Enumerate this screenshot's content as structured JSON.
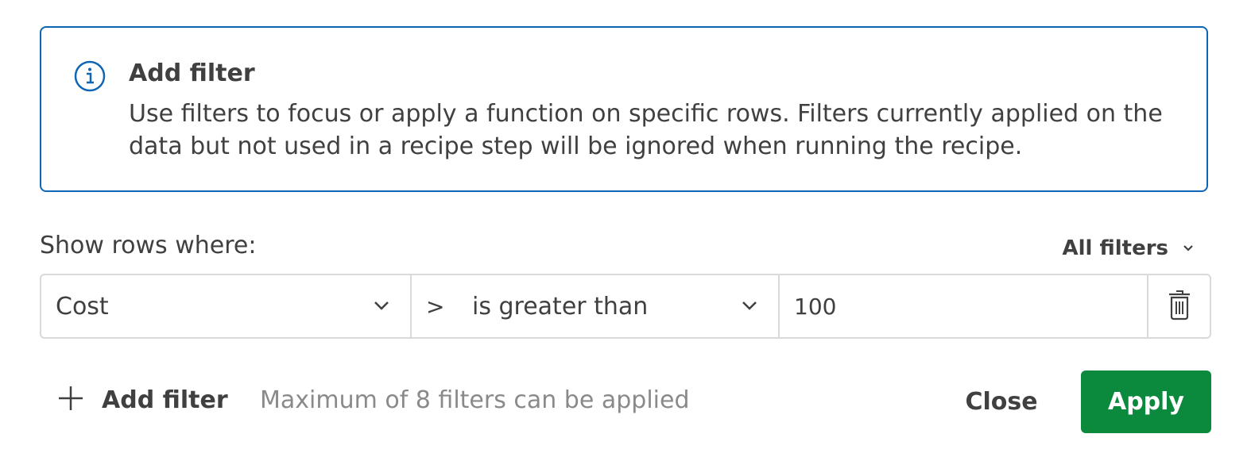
{
  "colors": {
    "accent_info": "#0e65b5",
    "primary_button": "#0b8a3e",
    "primary_button_text": "#ffffff",
    "text": "#404040",
    "muted_text": "#8a8a8a",
    "border": "#d9d9d9"
  },
  "info": {
    "icon": "info-icon",
    "title": "Add filter",
    "text": "Use filters to focus or apply a function on specific rows. Filters currently applied on the data but not used in a recipe step will be ignored when running the recipe."
  },
  "filters_header": {
    "label": "Show rows where:",
    "all_filters_label": "All filters",
    "all_filters_icon": "chevron-down-icon"
  },
  "filter_row": {
    "field": "Cost",
    "operator_symbol": ">",
    "operator_label": "is greater than",
    "value": "100",
    "delete_icon": "trash-icon"
  },
  "footer": {
    "add_filter_icon": "plus-icon",
    "add_filter_label": "Add filter",
    "max_note": "Maximum of 8 filters can be applied",
    "close_label": "Close",
    "apply_label": "Apply"
  }
}
